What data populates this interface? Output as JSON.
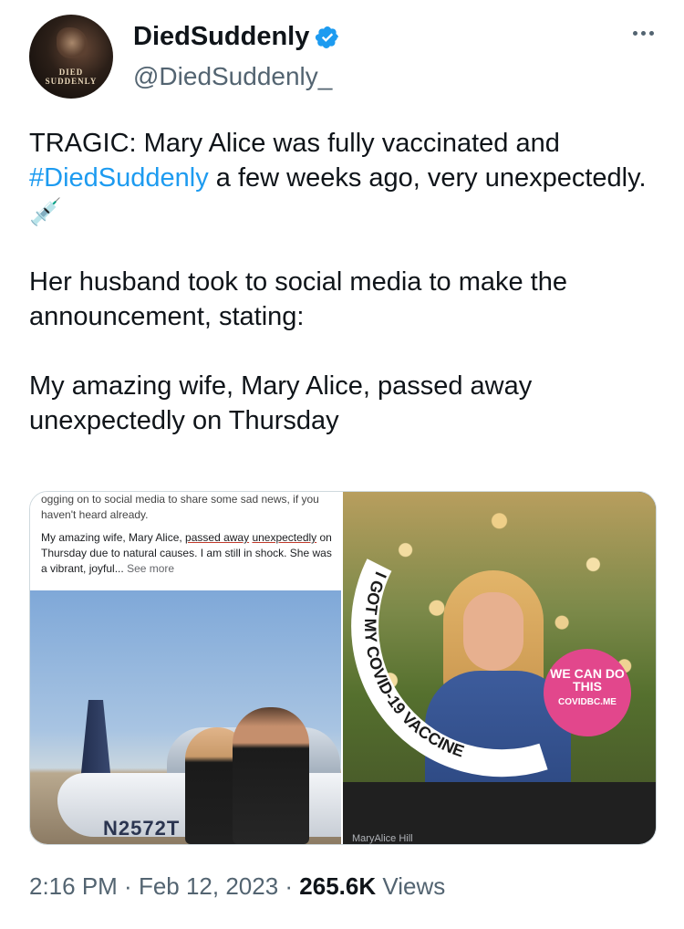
{
  "author": {
    "display_name": "DiedSuddenly",
    "handle": "@DiedSuddenly_",
    "avatar_text": "DIED SUDDENLY",
    "verified": true
  },
  "tweet": {
    "line1_prefix": "TRAGIC: Mary Alice was fully vaccinated and",
    "hashtag": "#DiedSuddenly",
    "line1_suffix": " a few weeks ago, very unexpectedly. 💉",
    "para2": "Her husband took to social media to make the announcement, stating:",
    "para3": "  My amazing wife, Mary Alice, passed away unexpectedly on Thursday"
  },
  "media": {
    "post_top": "ogging on to social media to share some sad news, if you haven't heard already.",
    "post_body_a": "My amazing wife, Mary Alice, ",
    "post_underline_1": "passed away",
    "post_underline_2": "unexpectedly",
    "post_body_b": " on Thursday due to natural causes. I am still in shock. She was a vibrant, joyful...",
    "see_more": "See more",
    "plane_registration": "N2572T",
    "ring_text": "I GOT MY COVID-19 VACCINE",
    "badge_line1": "WE CAN DO THIS",
    "badge_line2": "COVIDBC.ME",
    "name_caption": "MaryAlice Hill"
  },
  "meta": {
    "time": "2:16 PM",
    "date": "Feb 12, 2023",
    "views_count": "265.6K",
    "views_label": "Views"
  },
  "colors": {
    "link": "#1d9bf0",
    "verified": "#1d9bf0",
    "badge": "#e2478c"
  }
}
